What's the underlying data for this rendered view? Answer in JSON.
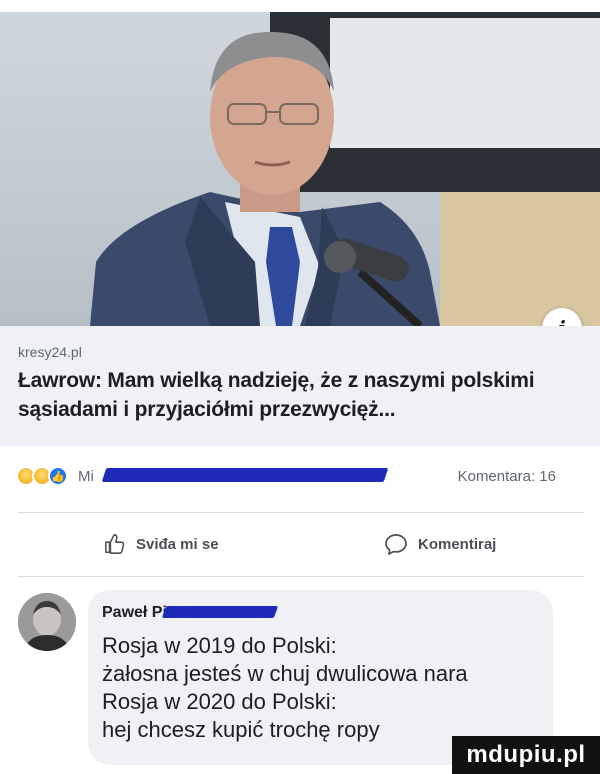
{
  "post": {
    "source": "kresy24.pl",
    "headline": "Ławrow: Mam wielką nadzieję, że z naszymi polskimi sąsiadami i przyjaciółmi przezwycięż...",
    "info_icon": "i",
    "reaction_names": "Mi",
    "comments_count": "Komentara: 16"
  },
  "actions": {
    "like_label": "Sviđa mi se",
    "comment_label": "Komentiraj"
  },
  "comment": {
    "author": "Paweł Pi",
    "lines": [
      "Rosja w 2019 do Polski:",
      "żałosna jesteś w chuj dwulicowa nara",
      "Rosja w 2020 do Polski:",
      "hej chcesz kupić trochę ropy"
    ]
  },
  "watermark": "mdupiu.pl",
  "colors": {
    "redaction": "#1d2bb8",
    "preview_bg": "#eff1f4",
    "like_blue": "#1877f2"
  }
}
